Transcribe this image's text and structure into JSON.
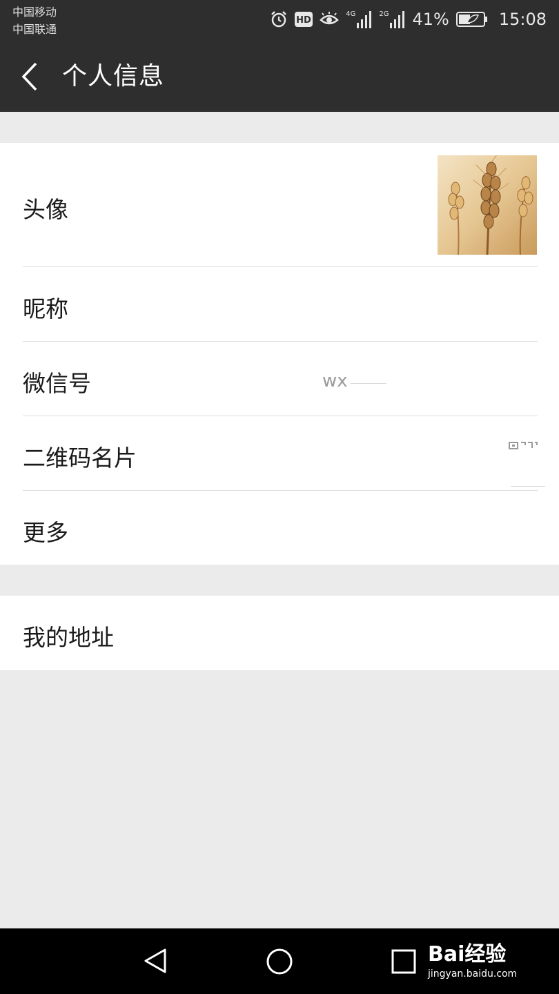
{
  "status_bar": {
    "carrier_1": "中国移动",
    "carrier_2": "中国联通",
    "network_1": "4G",
    "network_2": "2G",
    "battery_percent": "41%",
    "time": "15:08",
    "icons": [
      "alarm-icon",
      "hd-icon",
      "eye-icon",
      "signal-icon",
      "battery-icon"
    ]
  },
  "header": {
    "title": "个人信息",
    "back_icon": "chevron-left-icon"
  },
  "profile": {
    "avatar_label": "头像",
    "nickname_label": "昵称",
    "wechat_id_label": "微信号",
    "wechat_id_value": "wx",
    "qr_card_label": "二维码名片",
    "more_label": "更多"
  },
  "address": {
    "label": "我的地址"
  },
  "nav": {
    "back_icon": "triangle-back-icon",
    "home_icon": "circle-home-icon",
    "recent_icon": "square-recent-icon"
  },
  "watermark": {
    "brand": "Bai经验",
    "url": "jingyan.baidu.com"
  },
  "colors": {
    "header_bg": "#2e2e2e",
    "page_bg": "#ebebeb",
    "row_bg": "#ffffff",
    "nav_bg": "#000000"
  }
}
